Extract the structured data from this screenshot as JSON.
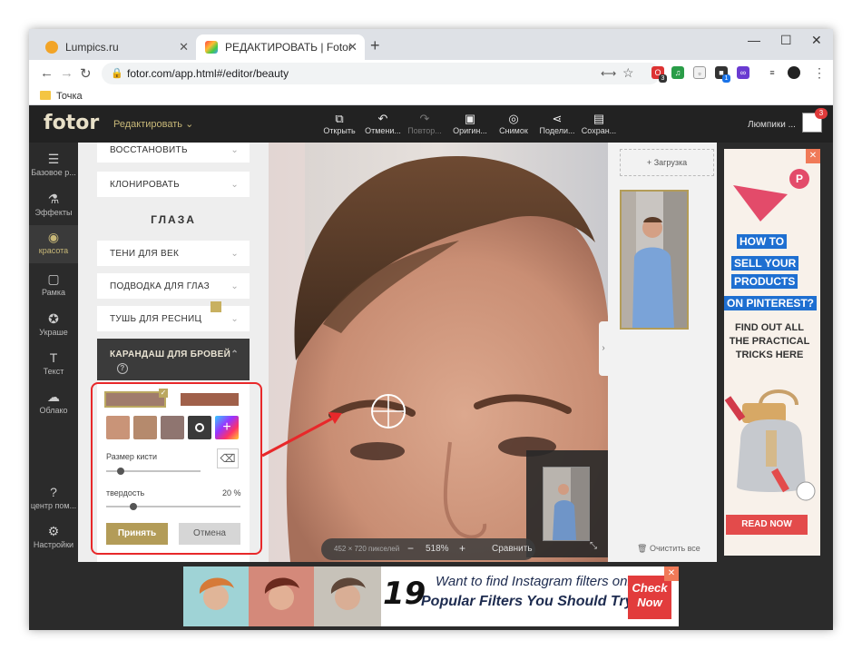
{
  "browser": {
    "tabs": [
      {
        "title": "Lumpics.ru",
        "active": false
      },
      {
        "title": "РЕДАКТИРОВАТЬ | Fotor",
        "active": true
      }
    ],
    "url": "fotor.com/app.html#/editor/beauty",
    "bookmark": "Точка",
    "ext_badge_1": "3",
    "ext_badge_2": "1"
  },
  "header": {
    "logo": "fotor",
    "menu_label": "Редактировать",
    "tools": [
      {
        "label": "Открыть",
        "icon": "open-image-icon",
        "disabled": false
      },
      {
        "label": "Отмени...",
        "icon": "undo-icon",
        "disabled": false
      },
      {
        "label": "Повтор...",
        "icon": "redo-icon",
        "disabled": true
      },
      {
        "label": "Оригин...",
        "icon": "original-icon",
        "disabled": false
      },
      {
        "label": "Снимок",
        "icon": "snapshot-icon",
        "disabled": false
      },
      {
        "label": "Подели...",
        "icon": "share-icon",
        "disabled": false
      },
      {
        "label": "Сохран...",
        "icon": "save-icon",
        "disabled": false
      }
    ],
    "user": "Люмпики ...",
    "notification_count": "3"
  },
  "rail": {
    "items": [
      {
        "label": "Базовое р...",
        "icon": "sliders-icon"
      },
      {
        "label": "Эффекты",
        "icon": "flask-icon"
      },
      {
        "label": "красота",
        "icon": "eye-icon",
        "active": true
      },
      {
        "label": "Рамка",
        "icon": "frame-icon"
      },
      {
        "label": "Украше",
        "icon": "sticker-icon"
      },
      {
        "label": "Текст",
        "icon": "text-icon"
      },
      {
        "label": "Облако",
        "icon": "cloud-icon"
      },
      {
        "label": "центр пом...",
        "icon": "help-icon"
      },
      {
        "label": "Настройки",
        "icon": "gear-icon"
      }
    ]
  },
  "panel": {
    "items_top": [
      "ВОССТАНОВИТЬ",
      "КЛОНИРОВАТЬ"
    ],
    "section_title": "ГЛАЗА",
    "items_eyes": [
      "ТЕНИ ДЛЯ ВЕК",
      "ПОДВОДКА ДЛЯ ГЛАЗ",
      "ТУШЬ ДЛЯ РЕСНИЦ"
    ],
    "open_item": "КАРАНДАШ ДЛЯ БРОВЕЙ",
    "brush_size_label": "Размер кисти",
    "brush_size": 0.15,
    "hardness_label": "твердость",
    "hardness_value": "20 %",
    "hardness": 0.2,
    "apply": "Принять",
    "cancel": "Отмена",
    "colors": [
      "#a07c6c",
      "#a0604a",
      "#c99478",
      "#b58a6d",
      "#8f7570"
    ]
  },
  "canvas": {
    "dims": "452 × 720 пикселей",
    "zoom": "518%",
    "compare": "Сравнить"
  },
  "right": {
    "upload": "Загрузка",
    "clear": "Очистить все"
  },
  "ad_right": {
    "l1": "HOW TO",
    "l2": "SELL YOUR",
    "l3": "PRODUCTS",
    "l4": "ON PINTEREST?",
    "find1": "FIND OUT ALL",
    "find2": "THE PRACTICAL",
    "find3": "TRICKS HERE",
    "read": "READ NOW"
  },
  "ad_bottom": {
    "number": "19",
    "line1": "Want to find Instagram filters online?",
    "line2": "Popular Filters You Should Try",
    "check1": "Check",
    "check2": "Now"
  }
}
